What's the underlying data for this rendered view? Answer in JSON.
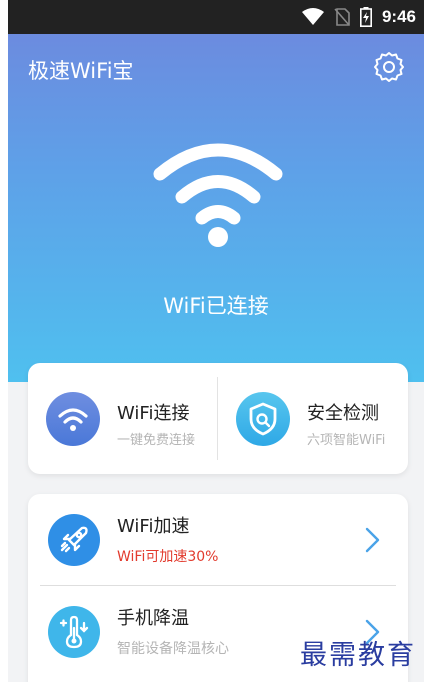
{
  "status_bar": {
    "time": "9:46",
    "icons": [
      "wifi-signal-icon",
      "no-sim-icon",
      "battery-charging-icon"
    ]
  },
  "header": {
    "title": "极速WiFi宝",
    "settings_icon": "gear-icon"
  },
  "hero": {
    "status_text": "WiFi已连接",
    "icon": "wifi-icon"
  },
  "features": [
    {
      "title": "WiFi连接",
      "subtitle": "一键免费连接",
      "icon": "wifi-icon"
    },
    {
      "title": "安全检测",
      "subtitle": "六项智能WiFi",
      "icon": "shield-check-icon"
    }
  ],
  "tools": [
    {
      "title": "WiFi加速",
      "subtitle": "WiFi可加速30%",
      "icon": "rocket-icon",
      "subtitle_color": "#e23b2e"
    },
    {
      "title": "手机降温",
      "subtitle": "智能设备降温核心",
      "icon": "thermometer-icon",
      "subtitle_color": "#b5b5b5"
    }
  ],
  "watermark": "最需教育",
  "colors": {
    "accent": "#2f8fe6",
    "hero_top": "#6f86dd",
    "hero_bottom": "#4fc0ef",
    "alert": "#e23b2e"
  }
}
